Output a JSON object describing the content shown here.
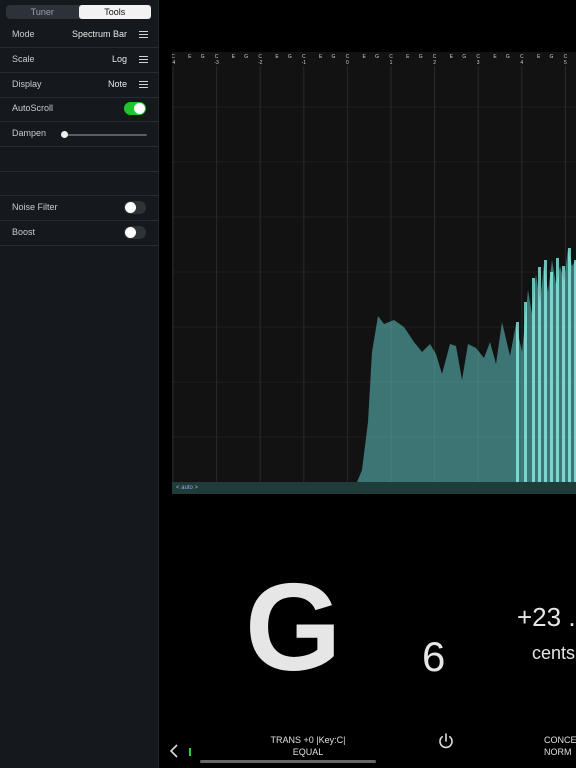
{
  "sidebar": {
    "tabs": [
      {
        "label": "Tuner",
        "active": false
      },
      {
        "label": "Tools",
        "active": true
      }
    ],
    "rows": {
      "mode": {
        "label": "Mode",
        "value": "Spectrum Bar"
      },
      "scale": {
        "label": "Scale",
        "value": "Log"
      },
      "display": {
        "label": "Display",
        "value": "Note"
      },
      "autoscroll": {
        "label": "AutoScroll",
        "on": true
      },
      "dampen": {
        "label": "Dampen",
        "level": 0.02
      },
      "noise_filter": {
        "label": "Noise Filter",
        "on": false
      },
      "boost": {
        "label": "Boost",
        "on": false
      }
    }
  },
  "spectrum": {
    "auto_label": "< auto >",
    "fill_color": "#5fc7c2",
    "octave_labels": [
      "-4",
      "-3",
      "-2",
      "-1",
      "0",
      "1",
      "2",
      "3",
      "4",
      "5"
    ],
    "note_labels": [
      "C",
      "E",
      "G"
    ]
  },
  "readout": {
    "note": "G",
    "octave": "6",
    "cents_value": "+23 .",
    "cents_label": "cents"
  },
  "footer": {
    "trans_line1": "TRANS +0 |Key:C|",
    "trans_line2": "EQUAL",
    "concert_line1": "CONCE",
    "concert_line2": "NORM",
    "level_color": "#2ecc40"
  }
}
